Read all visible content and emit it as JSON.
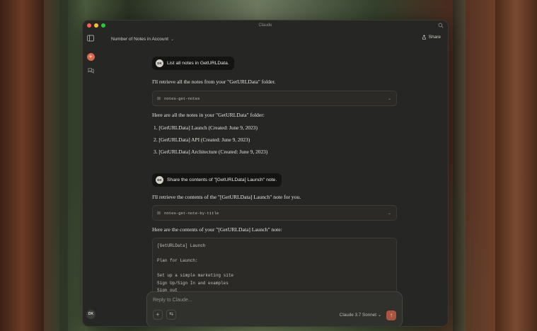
{
  "window": {
    "title": "Claude"
  },
  "header": {
    "conversation_title": "Number of Notes in Account",
    "share_label": "Share"
  },
  "sidebar": {
    "user_initials": "DK",
    "new_chat_icon": "plus-icon"
  },
  "messages": [
    {
      "role": "user",
      "initials": "DK",
      "text": "List all notes in GetURLData."
    },
    {
      "role": "assistant",
      "text": "I'll retrieve all the notes from your \"GetURLData\" folder."
    },
    {
      "role": "tool",
      "name": "notes-get-notes"
    },
    {
      "role": "assistant",
      "text": "Here are all the notes in your \"GetURLData\" folder:"
    },
    {
      "role": "list",
      "items": [
        "[GetURLData] Launch (Created: June 9, 2023)",
        "[GetURLData] API (Created: June 9, 2023)",
        "[GetURLData] Architecture (Created: June 9, 2023)"
      ]
    },
    {
      "role": "user",
      "initials": "DK",
      "text": "Share the contents of \"[GetURLData] Launch\" note."
    },
    {
      "role": "assistant",
      "text": "I'll retrieve the contents of the \"[GetURLData] Launch\" note for you."
    },
    {
      "role": "tool",
      "name": "notes-get-note-by-title"
    },
    {
      "role": "assistant",
      "text": "Here are the contents of your \"[GetURLData] Launch\" note:"
    },
    {
      "role": "code",
      "lines": [
        "[GetURLData] Launch",
        "",
        "Plan for Launch:",
        "",
        "Set up a simple marketing site",
        "Sign Up/Sign In and examples",
        "Sign out"
      ]
    }
  ],
  "composer": {
    "placeholder": "Reply to Claude...",
    "model_label": "Claude 3.7 Sonnet"
  },
  "colors": {
    "accent": "#d9674a",
    "send": "#a85640",
    "window_bg": "#262624"
  }
}
